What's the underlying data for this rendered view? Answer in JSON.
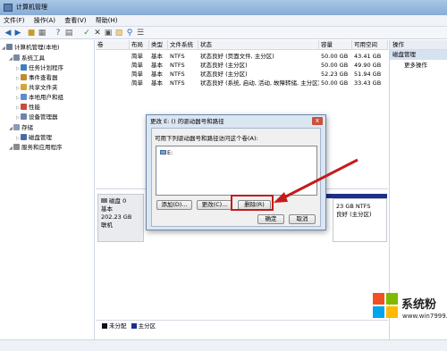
{
  "window": {
    "title": "计算机管理"
  },
  "menu": [
    "文件(F)",
    "操作(A)",
    "查看(V)",
    "帮助(H)"
  ],
  "tree": [
    {
      "label": "计算机管理(本地)",
      "level": 0,
      "color": "#6d7f99"
    },
    {
      "label": "系统工具",
      "level": 1,
      "color": "#7a8aa6"
    },
    {
      "label": "任务计划程序",
      "level": 2,
      "color": "#3f7fc1"
    },
    {
      "label": "事件查看器",
      "level": 2,
      "color": "#c08b2f"
    },
    {
      "label": "共享文件夹",
      "level": 2,
      "color": "#d1a73b"
    },
    {
      "label": "本地用户和组",
      "level": 2,
      "color": "#5d8ccc"
    },
    {
      "label": "性能",
      "level": 2,
      "color": "#cc4a3b"
    },
    {
      "label": "设备管理器",
      "level": 2,
      "color": "#6c86ab"
    },
    {
      "label": "存储",
      "level": 1,
      "color": "#8a9bb5"
    },
    {
      "label": "磁盘管理",
      "level": 2,
      "color": "#4a6d9e"
    },
    {
      "label": "服务和应用程序",
      "level": 1,
      "color": "#8b8b8b"
    }
  ],
  "volumes": {
    "headers": [
      "卷",
      "布局",
      "类型",
      "文件系统",
      "状态",
      "容量",
      "可用空间"
    ],
    "rows": [
      [
        "(D:)",
        "简单",
        "基本",
        "NTFS",
        "状态良好 (页面文件, 主分区)",
        "50.00 GB",
        "43.41 GB"
      ],
      [
        "(E:)",
        "简单",
        "基本",
        "NTFS",
        "状态良好 (主分区)",
        "50.00 GB",
        "49.90 GB"
      ],
      [
        "(F:)",
        "简单",
        "基本",
        "NTFS",
        "状态良好 (主分区)",
        "52.23 GB",
        "51.94 GB"
      ],
      [
        "系统 (C:)",
        "简单",
        "基本",
        "NTFS",
        "状态良好 (系统, 启动, 活动, 故障转储, 主分区)",
        "50.00 GB",
        "33.43 GB"
      ]
    ]
  },
  "actions": {
    "header": "操作",
    "section": "磁盘管理",
    "more": "更多操作"
  },
  "disk": {
    "name": "磁盘 0",
    "type": "基本",
    "size": "202.23 GB",
    "status": "联机",
    "partition_size": "23 GB NTFS",
    "partition_status": "良好 (主分区)"
  },
  "legend": [
    "未分配",
    "主分区"
  ],
  "legend_colors": [
    "#111111",
    "#1c2f8a"
  ],
  "dialog": {
    "title": "更改 E: () 的驱动器号和路径",
    "close": "x",
    "label": "可用下列驱动器号和路径访问这个卷(A):",
    "item": "E:",
    "add": "添加(D)...",
    "change": "更改(C)...",
    "remove": "删除(R)",
    "ok": "确定",
    "cancel": "取消"
  },
  "watermark": {
    "text": "系统粉",
    "url": "www.win7999.com"
  }
}
